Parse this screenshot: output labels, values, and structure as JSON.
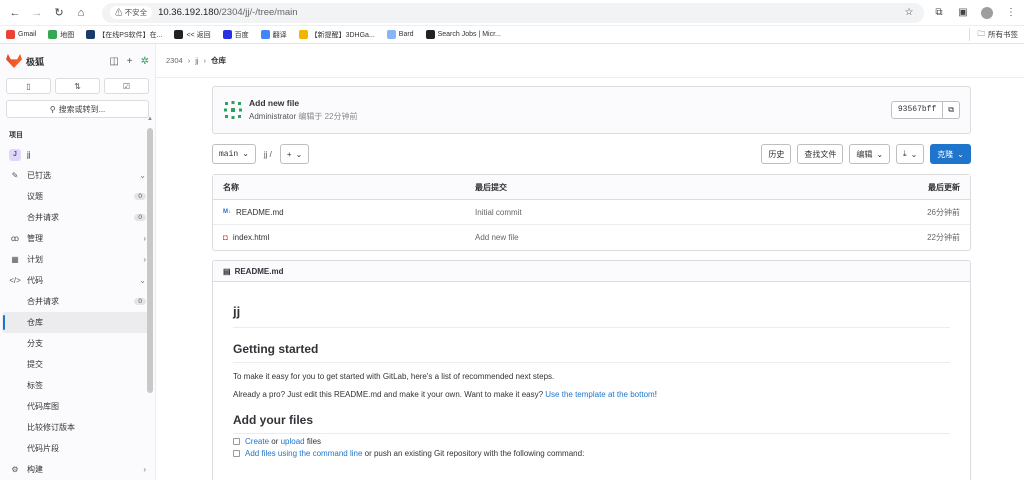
{
  "browser": {
    "insecure_label": "不安全",
    "url_host": "10.36.192.180",
    "url_path": "/2304/jj/-/tree/main",
    "bookmarks": [
      {
        "label": "Gmail",
        "color": "#ea4335"
      },
      {
        "label": "地图",
        "color": "#34a853"
      },
      {
        "label": "【在线PS软件】在...",
        "color": "#1a3a6b"
      },
      {
        "label": "<< 返回",
        "color": "#222222"
      },
      {
        "label": "百度",
        "color": "#2932e1"
      },
      {
        "label": "翻译",
        "color": "#4285f4"
      },
      {
        "label": "【新提醒】3DHGa...",
        "color": "#f4b400"
      },
      {
        "label": "Bard",
        "color": "#8ab4f8"
      },
      {
        "label": "Search Jobs | Micr...",
        "color": "#222222"
      }
    ],
    "all_bookmarks": "所有书签"
  },
  "sidebar": {
    "logo": "极狐",
    "search": "搜索或转到...",
    "section": "项目",
    "project": {
      "letter": "J",
      "name": "jj"
    },
    "pinned": "已钉选",
    "issues": "议题",
    "issues_count": "0",
    "merge_requests": "合并请求",
    "mr_count": "0",
    "manage": "管理",
    "plan": "计划",
    "code": "代码",
    "code_mr": "合并请求",
    "code_mr_count": "0",
    "repository": "仓库",
    "branches": "分支",
    "commits": "提交",
    "tags": "标签",
    "graph": "代码库图",
    "compare": "比较修订版本",
    "snippets": "代码片段",
    "build": "构建"
  },
  "breadcrumb": {
    "group": "2304",
    "project": "jj",
    "current": "仓库"
  },
  "commit": {
    "title": "Add new file",
    "author": "Administrator",
    "edited": "编辑于 22分钟前",
    "sha": "93567bff"
  },
  "toolbar": {
    "branch": "main",
    "path": "jj /",
    "add": "+",
    "history": "历史",
    "find_file": "查找文件",
    "edit": "编辑",
    "download": "",
    "clone": "克隆"
  },
  "files": {
    "headers": {
      "name": "名称",
      "last_commit": "最后提交",
      "last_update": "最后更新"
    },
    "rows": [
      {
        "name": "README.md",
        "commit": "Initial commit",
        "time": "26分钟前"
      },
      {
        "name": "index.html",
        "commit": "Add new file",
        "time": "22分钟前"
      }
    ]
  },
  "readme": {
    "filename": "README.md",
    "h1": "jj",
    "h2_started": "Getting started",
    "p1": "To make it easy for you to get started with GitLab, here's a list of recommended next steps.",
    "p2_text": "Already a pro? Just edit this README.md and make it your own. Want to make it easy? ",
    "p2_link": "Use the template at the bottom",
    "p2_end": "!",
    "h2_files": "Add your files",
    "task1_link1": "Create",
    "task1_or": " or ",
    "task1_link2": "upload",
    "task1_end": " files",
    "task2_link": "Add files using the command line",
    "task2_end": " or push an existing Git repository with the following command:"
  }
}
